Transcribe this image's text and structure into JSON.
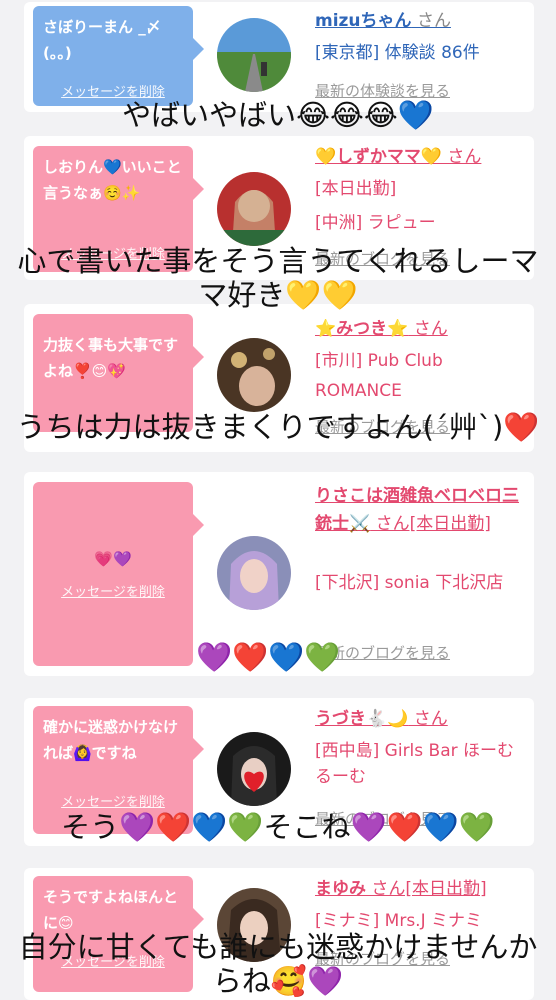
{
  "cards": [
    {
      "message": "さぼりーまん _〆(。。)",
      "delete_label": "メッセージを削除",
      "name": "mizuちゃん",
      "san": " さん",
      "info": [
        "[東京都] 体験談 86件"
      ],
      "link": "最新の体験談を見る"
    },
    {
      "message": "しおりん💙いいこと言うなぁ☺️✨",
      "delete_label": "メッセージを削除",
      "name": "💛しずかママ💛",
      "san": " さん",
      "info": [
        "[本日出勤]",
        "[中洲] ラピュー"
      ],
      "link": "最新のブログを見る"
    },
    {
      "message": "力抜く事も大事ですよね❣️😊💖",
      "delete_label": "メッセージを削除",
      "name": "⭐みつき⭐",
      "san": " さん",
      "info": [
        "[市川] Pub Club",
        "ROMANCE"
      ],
      "link": "最新のブログを見る"
    },
    {
      "message": "💗💜",
      "delete_label": "メッセージを削除",
      "name": "りさこは酒雑魚ベロベロ三銃士⚔️",
      "san": " さん[本日出勤]",
      "info": [
        "[下北沢] sonia 下北沢店"
      ],
      "link": "最新のブログを見る"
    },
    {
      "message": "確かに迷惑かけなければ🙆‍♀️ですね",
      "delete_label": "メッセージを削除",
      "name": "うづき🐇🌙",
      "san": " さん",
      "info": [
        "[西中島] Girls Bar ほーむるーむ"
      ],
      "link": "最新のブログを見る"
    },
    {
      "message": "そうですよねほんとに😊",
      "delete_label": "メッセージを削除",
      "name": "まゆみ",
      "san": " さん[本日出勤]",
      "info": [
        "[ミナミ] Mrs.J ミナミ"
      ],
      "link": "最新のブログを見る"
    }
  ],
  "overlays": [
    "やばいやばい😂😂😂💙",
    "心で書いた事をそう言うてくれるしーママ好き💛💛",
    "うちは力は抜きまくりですよん(´艸`)❤️",
    "💜❤️💙💚",
    "そう💜❤️💙💚そこね💜❤️💙💚",
    "自分に甘くても誰にも迷惑かけませんからね🥰💜"
  ],
  "colors": {
    "pink_bubble": "#f99ab0",
    "blue_bubble": "#7fb0ea",
    "name_pink": "#e3496f",
    "name_blue": "#2f66b8"
  }
}
